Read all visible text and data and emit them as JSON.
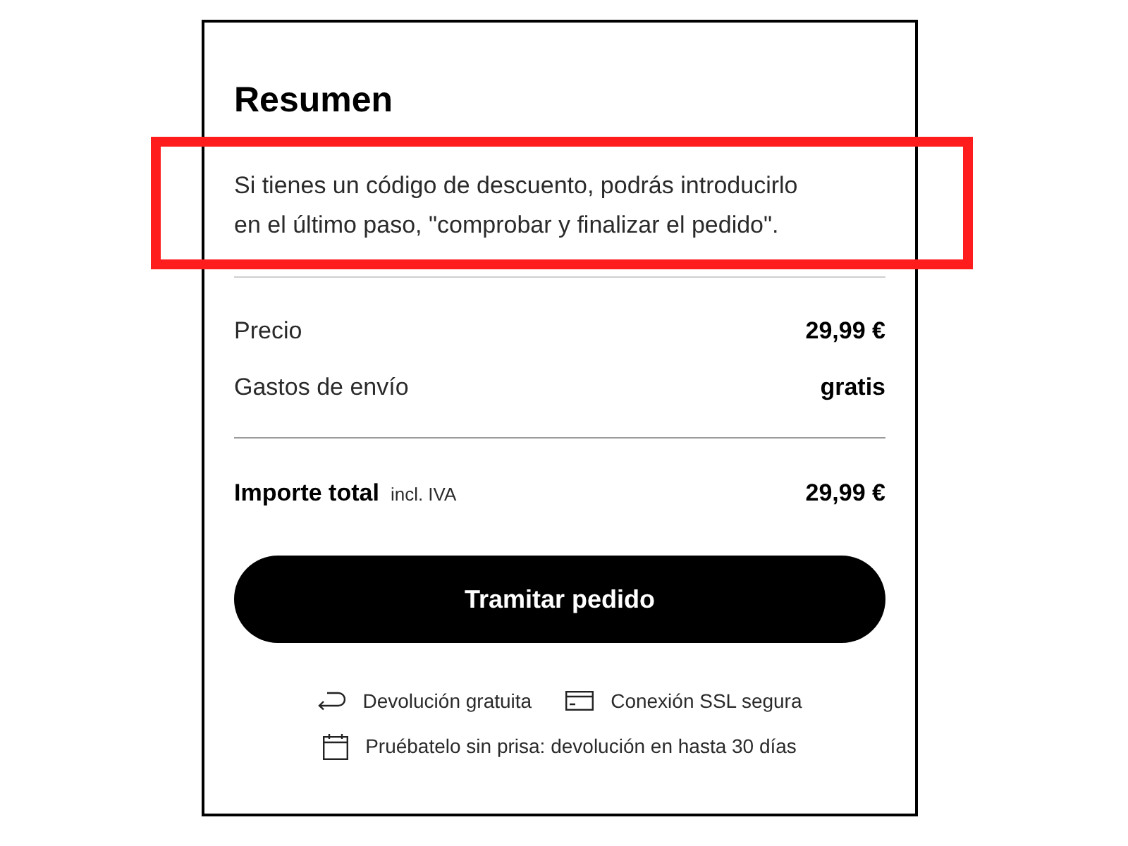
{
  "summary": {
    "title": "Resumen",
    "notice": {
      "text": "Si tienes un código de descuento, podrás introducirlo en el último paso, \"comprobar y finalizar el pedido\".",
      "highlighted": true
    },
    "lines": [
      {
        "label": "Precio",
        "value": "29,99 €"
      },
      {
        "label": "Gastos de envío",
        "value": "gratis"
      }
    ],
    "total": {
      "label": "Importe total",
      "note": "incl. IVA",
      "value": "29,99 €"
    },
    "button": "Tramitar pedido",
    "feature_rows": [
      {
        "items": [
          {
            "kind": "return",
            "text": "Devolución gratuita"
          },
          {
            "kind": "card",
            "text": "Conexión SSL segura"
          }
        ]
      },
      {
        "items": [
          {
            "kind": "calendar",
            "text": "Pruébatelo sin prisa: devolución en hasta 30 días"
          }
        ]
      }
    ]
  }
}
